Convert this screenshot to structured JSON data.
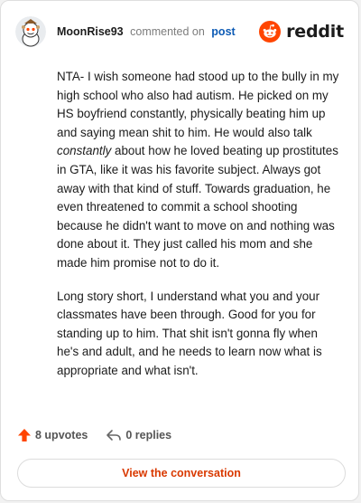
{
  "comment": {
    "author": "MoonRise93",
    "action_text": "commented on",
    "post_link": "post",
    "brand": "reddit",
    "paragraph1_before": "NTA- I wish someone had stood up to the bully in my high school who also had autism. He picked on my HS boyfriend constantly, physically beating him up and saying mean shit to him. He would also talk ",
    "paragraph1_emphasis": "constantly",
    "paragraph1_after": " about how he loved beating up prostitutes in GTA, like it was his favorite subject. Always got away with that kind of stuff. Towards graduation, he even threatened to commit a school shooting because he didn't want to move on and nothing was done about it. They just called his mom and she made him promise not to do it.",
    "paragraph2": "Long story short, I understand what you and your classmates have been through. Good for you for standing up to him. That shit isn't gonna fly when he's and adult, and he needs to learn now what is appropriate and what isn't."
  },
  "actions": {
    "upvotes": "8 upvotes",
    "replies": "0 replies"
  },
  "cta": {
    "label": "View the conversation"
  },
  "colors": {
    "brand_orange": "#ff4500",
    "link_blue": "#0d5bb5",
    "cta_text": "#d93900"
  },
  "icons": {
    "upvote": "upvote-arrow-icon",
    "reply": "reply-arrow-icon",
    "brand": "reddit-snoo-icon"
  }
}
